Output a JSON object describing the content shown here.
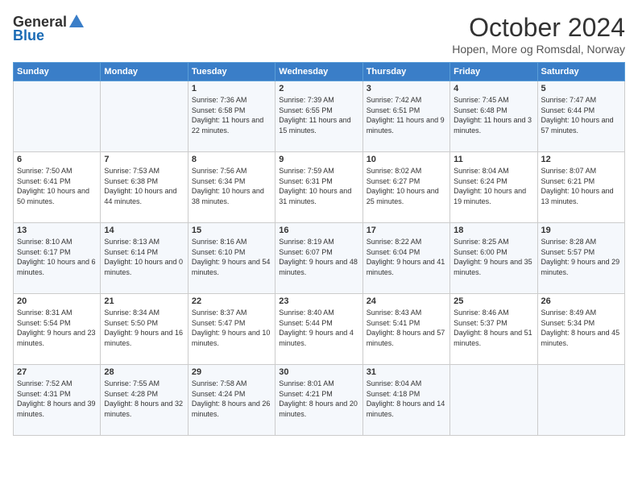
{
  "header": {
    "logo": {
      "general": "General",
      "blue": "Blue"
    },
    "title": "October 2024",
    "location": "Hopen, More og Romsdal, Norway"
  },
  "weekdays": [
    "Sunday",
    "Monday",
    "Tuesday",
    "Wednesday",
    "Thursday",
    "Friday",
    "Saturday"
  ],
  "weeks": [
    [
      {
        "day": "",
        "sunrise": "",
        "sunset": "",
        "daylight": ""
      },
      {
        "day": "",
        "sunrise": "",
        "sunset": "",
        "daylight": ""
      },
      {
        "day": "1",
        "sunrise": "Sunrise: 7:36 AM",
        "sunset": "Sunset: 6:58 PM",
        "daylight": "Daylight: 11 hours and 22 minutes."
      },
      {
        "day": "2",
        "sunrise": "Sunrise: 7:39 AM",
        "sunset": "Sunset: 6:55 PM",
        "daylight": "Daylight: 11 hours and 15 minutes."
      },
      {
        "day": "3",
        "sunrise": "Sunrise: 7:42 AM",
        "sunset": "Sunset: 6:51 PM",
        "daylight": "Daylight: 11 hours and 9 minutes."
      },
      {
        "day": "4",
        "sunrise": "Sunrise: 7:45 AM",
        "sunset": "Sunset: 6:48 PM",
        "daylight": "Daylight: 11 hours and 3 minutes."
      },
      {
        "day": "5",
        "sunrise": "Sunrise: 7:47 AM",
        "sunset": "Sunset: 6:44 PM",
        "daylight": "Daylight: 10 hours and 57 minutes."
      }
    ],
    [
      {
        "day": "6",
        "sunrise": "Sunrise: 7:50 AM",
        "sunset": "Sunset: 6:41 PM",
        "daylight": "Daylight: 10 hours and 50 minutes."
      },
      {
        "day": "7",
        "sunrise": "Sunrise: 7:53 AM",
        "sunset": "Sunset: 6:38 PM",
        "daylight": "Daylight: 10 hours and 44 minutes."
      },
      {
        "day": "8",
        "sunrise": "Sunrise: 7:56 AM",
        "sunset": "Sunset: 6:34 PM",
        "daylight": "Daylight: 10 hours and 38 minutes."
      },
      {
        "day": "9",
        "sunrise": "Sunrise: 7:59 AM",
        "sunset": "Sunset: 6:31 PM",
        "daylight": "Daylight: 10 hours and 31 minutes."
      },
      {
        "day": "10",
        "sunrise": "Sunrise: 8:02 AM",
        "sunset": "Sunset: 6:27 PM",
        "daylight": "Daylight: 10 hours and 25 minutes."
      },
      {
        "day": "11",
        "sunrise": "Sunrise: 8:04 AM",
        "sunset": "Sunset: 6:24 PM",
        "daylight": "Daylight: 10 hours and 19 minutes."
      },
      {
        "day": "12",
        "sunrise": "Sunrise: 8:07 AM",
        "sunset": "Sunset: 6:21 PM",
        "daylight": "Daylight: 10 hours and 13 minutes."
      }
    ],
    [
      {
        "day": "13",
        "sunrise": "Sunrise: 8:10 AM",
        "sunset": "Sunset: 6:17 PM",
        "daylight": "Daylight: 10 hours and 6 minutes."
      },
      {
        "day": "14",
        "sunrise": "Sunrise: 8:13 AM",
        "sunset": "Sunset: 6:14 PM",
        "daylight": "Daylight: 10 hours and 0 minutes."
      },
      {
        "day": "15",
        "sunrise": "Sunrise: 8:16 AM",
        "sunset": "Sunset: 6:10 PM",
        "daylight": "Daylight: 9 hours and 54 minutes."
      },
      {
        "day": "16",
        "sunrise": "Sunrise: 8:19 AM",
        "sunset": "Sunset: 6:07 PM",
        "daylight": "Daylight: 9 hours and 48 minutes."
      },
      {
        "day": "17",
        "sunrise": "Sunrise: 8:22 AM",
        "sunset": "Sunset: 6:04 PM",
        "daylight": "Daylight: 9 hours and 41 minutes."
      },
      {
        "day": "18",
        "sunrise": "Sunrise: 8:25 AM",
        "sunset": "Sunset: 6:00 PM",
        "daylight": "Daylight: 9 hours and 35 minutes."
      },
      {
        "day": "19",
        "sunrise": "Sunrise: 8:28 AM",
        "sunset": "Sunset: 5:57 PM",
        "daylight": "Daylight: 9 hours and 29 minutes."
      }
    ],
    [
      {
        "day": "20",
        "sunrise": "Sunrise: 8:31 AM",
        "sunset": "Sunset: 5:54 PM",
        "daylight": "Daylight: 9 hours and 23 minutes."
      },
      {
        "day": "21",
        "sunrise": "Sunrise: 8:34 AM",
        "sunset": "Sunset: 5:50 PM",
        "daylight": "Daylight: 9 hours and 16 minutes."
      },
      {
        "day": "22",
        "sunrise": "Sunrise: 8:37 AM",
        "sunset": "Sunset: 5:47 PM",
        "daylight": "Daylight: 9 hours and 10 minutes."
      },
      {
        "day": "23",
        "sunrise": "Sunrise: 8:40 AM",
        "sunset": "Sunset: 5:44 PM",
        "daylight": "Daylight: 9 hours and 4 minutes."
      },
      {
        "day": "24",
        "sunrise": "Sunrise: 8:43 AM",
        "sunset": "Sunset: 5:41 PM",
        "daylight": "Daylight: 8 hours and 57 minutes."
      },
      {
        "day": "25",
        "sunrise": "Sunrise: 8:46 AM",
        "sunset": "Sunset: 5:37 PM",
        "daylight": "Daylight: 8 hours and 51 minutes."
      },
      {
        "day": "26",
        "sunrise": "Sunrise: 8:49 AM",
        "sunset": "Sunset: 5:34 PM",
        "daylight": "Daylight: 8 hours and 45 minutes."
      }
    ],
    [
      {
        "day": "27",
        "sunrise": "Sunrise: 7:52 AM",
        "sunset": "Sunset: 4:31 PM",
        "daylight": "Daylight: 8 hours and 39 minutes."
      },
      {
        "day": "28",
        "sunrise": "Sunrise: 7:55 AM",
        "sunset": "Sunset: 4:28 PM",
        "daylight": "Daylight: 8 hours and 32 minutes."
      },
      {
        "day": "29",
        "sunrise": "Sunrise: 7:58 AM",
        "sunset": "Sunset: 4:24 PM",
        "daylight": "Daylight: 8 hours and 26 minutes."
      },
      {
        "day": "30",
        "sunrise": "Sunrise: 8:01 AM",
        "sunset": "Sunset: 4:21 PM",
        "daylight": "Daylight: 8 hours and 20 minutes."
      },
      {
        "day": "31",
        "sunrise": "Sunrise: 8:04 AM",
        "sunset": "Sunset: 4:18 PM",
        "daylight": "Daylight: 8 hours and 14 minutes."
      },
      {
        "day": "",
        "sunrise": "",
        "sunset": "",
        "daylight": ""
      },
      {
        "day": "",
        "sunrise": "",
        "sunset": "",
        "daylight": ""
      }
    ]
  ]
}
